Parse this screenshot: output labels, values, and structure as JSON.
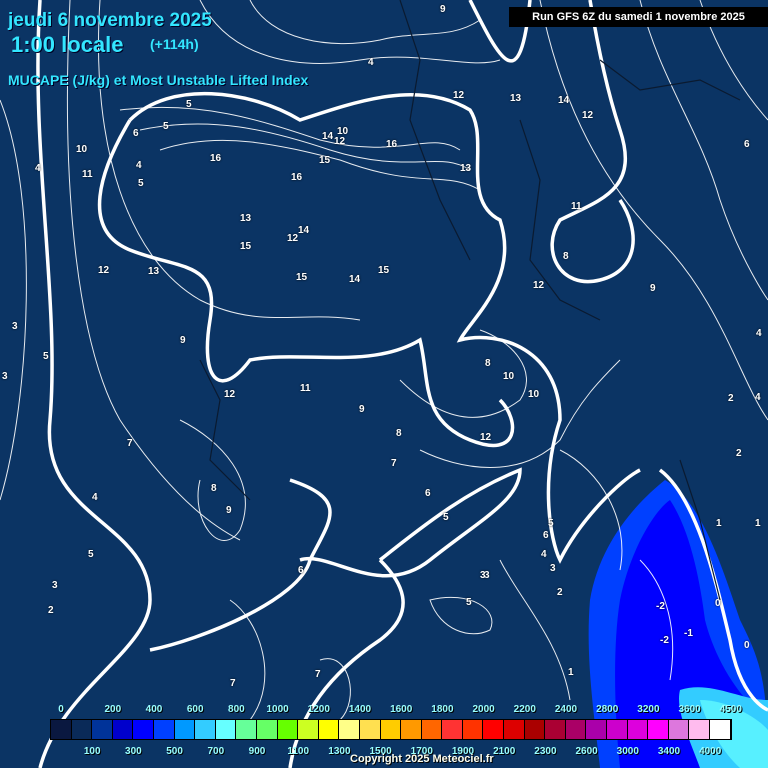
{
  "header": {
    "date": "jeudi 6 novembre 2025",
    "time": "1:00 locale",
    "lead": "(+114h)",
    "parameter": "MUCAPE (J/kg) et Most Unstable Lifted Index",
    "run": "Run GFS 6Z du samedi 1 novembre 2025"
  },
  "legend": {
    "top_labels": [
      "0",
      "200",
      "400",
      "600",
      "800",
      "1000",
      "1200",
      "1400",
      "1600",
      "1800",
      "2000",
      "2200",
      "2400",
      "2800",
      "3200",
      "3600",
      "4500"
    ],
    "bottom_labels": [
      "100",
      "300",
      "500",
      "700",
      "900",
      "1100",
      "1300",
      "1500",
      "1700",
      "1900",
      "2100",
      "2300",
      "2600",
      "3000",
      "3400",
      "4000"
    ],
    "colors": [
      "#0a1840",
      "#0a2a58",
      "#003399",
      "#0000cc",
      "#0000ff",
      "#0040ff",
      "#0099ff",
      "#33ccff",
      "#66ffff",
      "#66ff99",
      "#66ff66",
      "#66ff00",
      "#ccff22",
      "#ffff00",
      "#ffff88",
      "#ffe050",
      "#ffcc00",
      "#ff9900",
      "#ff6600",
      "#ff3333",
      "#ff3300",
      "#ff0000",
      "#dd0000",
      "#aa0000",
      "#aa0033",
      "#aa0066",
      "#aa00aa",
      "#cc00cc",
      "#dd00dd",
      "#ff00ff",
      "#dd77dd",
      "#ffbbee",
      "#ffffff"
    ]
  },
  "contour_labels": [
    "9",
    "4",
    "5",
    "6",
    "5",
    "4",
    "5",
    "10",
    "11",
    "16",
    "12",
    "13",
    "14",
    "12",
    "6",
    "14",
    "10",
    "12",
    "16",
    "15",
    "16",
    "13",
    "11",
    "15",
    "13",
    "12",
    "14",
    "15",
    "15",
    "14",
    "13",
    "12",
    "8",
    "9",
    "9",
    "11",
    "12",
    "10",
    "8",
    "10",
    "12",
    "9",
    "8",
    "7",
    "12",
    "3",
    "5",
    "3",
    "2",
    "4",
    "4",
    "4",
    "7",
    "8",
    "9",
    "6",
    "5",
    "4",
    "5",
    "3",
    "6",
    "5",
    "6",
    "3",
    "2",
    "2",
    "1",
    "1",
    "0",
    "0",
    "-2",
    "-2",
    "-1",
    "1",
    "2",
    "3",
    "4",
    "3",
    "7",
    "7",
    "5"
  ],
  "copyright": "Copyright 2025 Meteociel.fr"
}
